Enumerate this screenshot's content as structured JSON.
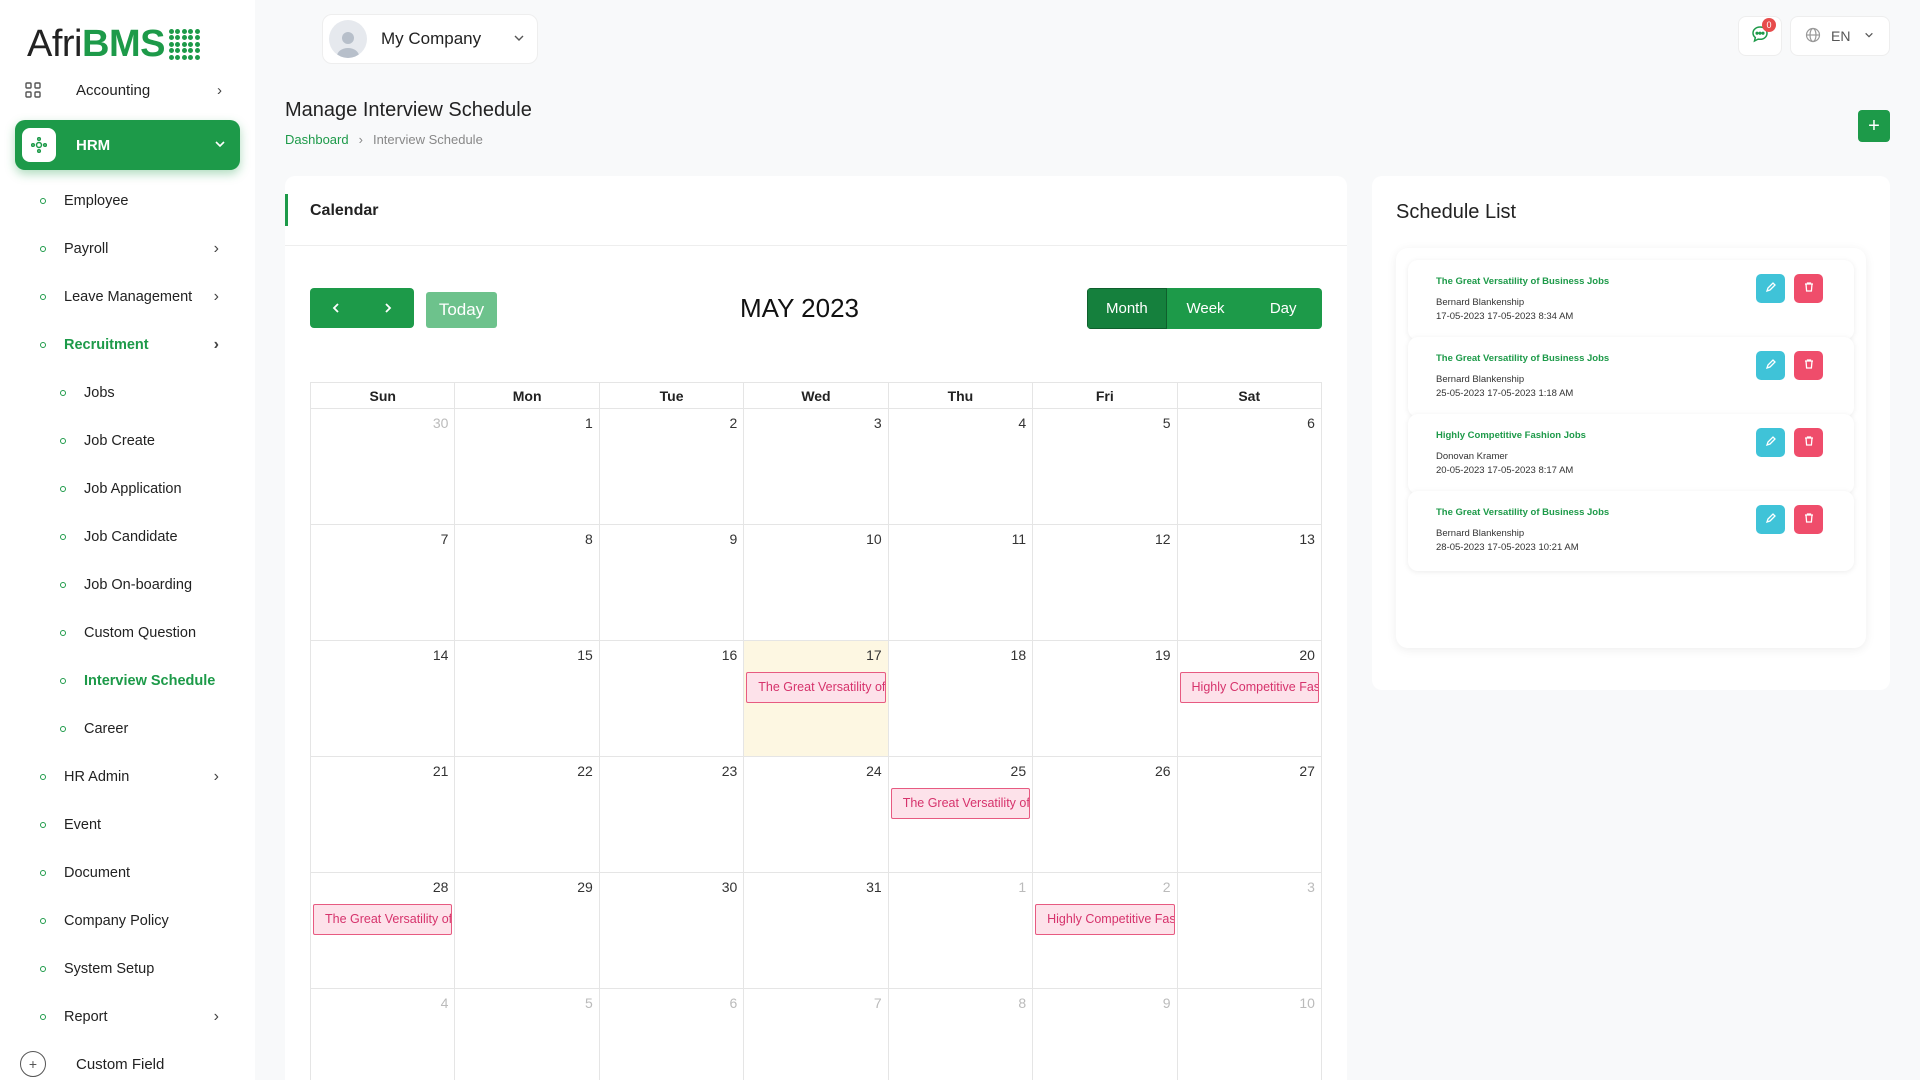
{
  "brand": {
    "part1": "Afri",
    "part2": "BMS"
  },
  "sidebar": {
    "top_item": "Accounting",
    "active_group": "HRM",
    "items": [
      {
        "label": "Employee",
        "level": 1,
        "chevron": false,
        "active": false
      },
      {
        "label": "Payroll",
        "level": 1,
        "chevron": true,
        "active": false
      },
      {
        "label": "Leave Management",
        "level": 1,
        "chevron": true,
        "active": false
      },
      {
        "label": "Recruitment",
        "level": 1,
        "chevron": true,
        "active": true
      },
      {
        "label": "Jobs",
        "level": 2,
        "chevron": false,
        "active": false
      },
      {
        "label": "Job Create",
        "level": 2,
        "chevron": false,
        "active": false
      },
      {
        "label": "Job Application",
        "level": 2,
        "chevron": false,
        "active": false
      },
      {
        "label": "Job Candidate",
        "level": 2,
        "chevron": false,
        "active": false
      },
      {
        "label": "Job On-boarding",
        "level": 2,
        "chevron": false,
        "active": false
      },
      {
        "label": "Custom Question",
        "level": 2,
        "chevron": false,
        "active": false
      },
      {
        "label": "Interview Schedule",
        "level": 2,
        "chevron": false,
        "active": true
      },
      {
        "label": "Career",
        "level": 2,
        "chevron": false,
        "active": false
      },
      {
        "label": "HR Admin",
        "level": 1,
        "chevron": true,
        "active": false
      },
      {
        "label": "Event",
        "level": 1,
        "chevron": false,
        "active": false
      },
      {
        "label": "Document",
        "level": 1,
        "chevron": false,
        "active": false
      },
      {
        "label": "Company Policy",
        "level": 1,
        "chevron": false,
        "active": false
      },
      {
        "label": "System Setup",
        "level": 1,
        "chevron": false,
        "active": false
      },
      {
        "label": "Report",
        "level": 1,
        "chevron": true,
        "active": false
      }
    ],
    "bottom_item": "Custom Field"
  },
  "header": {
    "company": "My Company",
    "message_count": "0",
    "language": "EN"
  },
  "page": {
    "title": "Manage Interview Schedule",
    "breadcrumb_home": "Dashboard",
    "breadcrumb_current": "Interview Schedule",
    "add_label": "+"
  },
  "calendar": {
    "card_title": "Calendar",
    "today_label": "Today",
    "month_title": "MAY 2023",
    "views": [
      "Month",
      "Week",
      "Day"
    ],
    "active_view": "Month",
    "weekdays": [
      "Sun",
      "Mon",
      "Tue",
      "Wed",
      "Thu",
      "Fri",
      "Sat"
    ],
    "weeks": [
      [
        {
          "d": "30",
          "other": true
        },
        {
          "d": "1"
        },
        {
          "d": "2"
        },
        {
          "d": "3"
        },
        {
          "d": "4"
        },
        {
          "d": "5"
        },
        {
          "d": "6"
        }
      ],
      [
        {
          "d": "7"
        },
        {
          "d": "8"
        },
        {
          "d": "9"
        },
        {
          "d": "10"
        },
        {
          "d": "11"
        },
        {
          "d": "12"
        },
        {
          "d": "13"
        }
      ],
      [
        {
          "d": "14"
        },
        {
          "d": "15"
        },
        {
          "d": "16"
        },
        {
          "d": "17",
          "today": true,
          "event": "The Great Versatility of Business Jobs"
        },
        {
          "d": "18"
        },
        {
          "d": "19"
        },
        {
          "d": "20",
          "event": "Highly Competitive Fashion Jobs"
        }
      ],
      [
        {
          "d": "21"
        },
        {
          "d": "22"
        },
        {
          "d": "23"
        },
        {
          "d": "24"
        },
        {
          "d": "25",
          "event": "The Great Versatility of Business Jobs"
        },
        {
          "d": "26"
        },
        {
          "d": "27"
        }
      ],
      [
        {
          "d": "28",
          "event": "The Great Versatility of Business Jobs"
        },
        {
          "d": "29"
        },
        {
          "d": "30"
        },
        {
          "d": "31"
        },
        {
          "d": "1",
          "other": true
        },
        {
          "d": "2",
          "other": true,
          "event": "Highly Competitive Fashion Jobs"
        },
        {
          "d": "3",
          "other": true
        }
      ],
      [
        {
          "d": "4",
          "other": true
        },
        {
          "d": "5",
          "other": true
        },
        {
          "d": "6",
          "other": true
        },
        {
          "d": "7",
          "other": true
        },
        {
          "d": "8",
          "other": true
        },
        {
          "d": "9",
          "other": true
        },
        {
          "d": "10",
          "other": true
        }
      ]
    ]
  },
  "schedule": {
    "title": "Schedule List",
    "items": [
      {
        "job": "The Great Versatility of Business Jobs",
        "candidate": "Bernard Blankenship",
        "datetime": "17-05-2023 17-05-2023 8:34 AM"
      },
      {
        "job": "The Great Versatility of Business Jobs",
        "candidate": "Bernard Blankenship",
        "datetime": "25-05-2023 17-05-2023 1:18 AM"
      },
      {
        "job": "Highly Competitive Fashion Jobs",
        "candidate": "Donovan Kramer",
        "datetime": "20-05-2023 17-05-2023 8:17 AM"
      },
      {
        "job": "The Great Versatility of Business Jobs",
        "candidate": "Bernard Blankenship",
        "datetime": "28-05-2023 17-05-2023 10:21 AM"
      }
    ]
  },
  "colors": {
    "primary": "#1d9a49",
    "event_bg": "#fde2ea",
    "event_text": "#d6336c",
    "edit": "#3fc3d8",
    "delete": "#ef4d6b"
  },
  "icons": {
    "top_item": "grid-icon",
    "hrm": "hrm-icon",
    "bottom_item": "plus-circle-icon",
    "messages": "chat-icon",
    "language": "globe-icon"
  }
}
